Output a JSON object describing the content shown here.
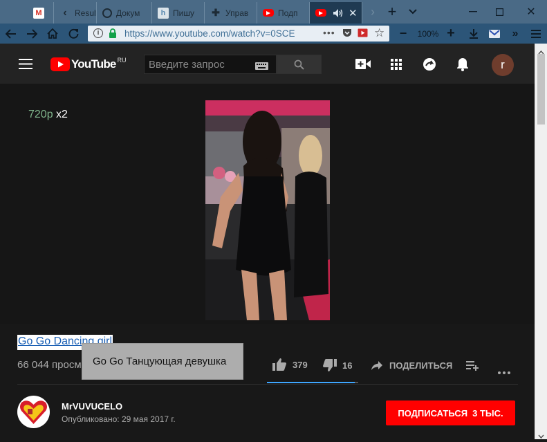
{
  "browser": {
    "tabs": [
      {
        "label": "",
        "favicon": "gmail-icon"
      },
      {
        "label": "Result",
        "favicon": "back-icon"
      },
      {
        "label": "Докум",
        "favicon": "docs-icon"
      },
      {
        "label": "Пишу",
        "favicon": "habr-icon"
      },
      {
        "label": "Управ",
        "favicon": "puzzle-icon"
      },
      {
        "label": "Подп",
        "favicon": "youtube-icon"
      },
      {
        "label": "",
        "favicon": "youtube-icon"
      }
    ],
    "url": "https://www.youtube.com/watch?v=0SCE",
    "zoom": "100%"
  },
  "youtube": {
    "logo_text": "YouTube",
    "logo_region": "RU",
    "search_placeholder": "Введите запрос",
    "avatar_letter": "r"
  },
  "player": {
    "quality": "720p",
    "speed": "x2"
  },
  "video": {
    "title": "Go Go Dancing girl",
    "views": "66 044 просм",
    "tooltip": "Go Go Танцующая девушка",
    "likes": "379",
    "dislikes": "16",
    "share_label": "ПОДЕЛИТЬСЯ",
    "like_ratio": 0.96
  },
  "channel": {
    "name": "MrVUVUCELO",
    "published": "Опубликовано: 29 мая 2017 г.",
    "subscribe_label": "ПОДПИСАТЬСЯ",
    "subscribers": "3 ТЫС."
  },
  "colors": {
    "yt_red": "#ff0000",
    "accent_blue": "#3ea6ff",
    "quality_green": "#7fb48b"
  }
}
